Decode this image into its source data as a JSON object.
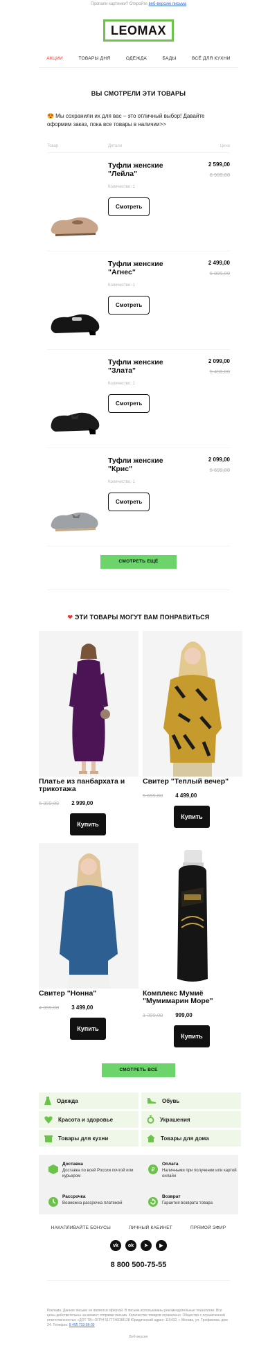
{
  "preheader": {
    "text": "Пропали картинки? Откройте",
    "link": "веб-версию письма"
  },
  "logo": "LEOMAX",
  "nav": [
    "АКЦИИ",
    "ТОВАРЫ ДНЯ",
    "ОДЕЖДА",
    "БАДЫ",
    "ВСЁ ДЛЯ КУХНИ"
  ],
  "viewed": {
    "title": "ВЫ СМОТРЕЛИ ЭТИ ТОВАРЫ",
    "lead": "😍 Мы сохранили их для вас – это отличный выбор! Давайте оформим заказ, пока все товары в наличии>>",
    "headers": {
      "product": "Товар",
      "details": "Детали",
      "price": "Цена"
    },
    "items": [
      {
        "title": "Туфли женские \"Лейла\"",
        "qty": "Количество: 1",
        "button": "Смотреть",
        "price": "2 599,00",
        "old": "6 999,00",
        "color": "#c8a488"
      },
      {
        "title": "Туфли женские \"Агнес\"",
        "qty": "Количество: 1",
        "button": "Смотреть",
        "price": "2 499,00",
        "old": "6 899,00",
        "color": "#151515"
      },
      {
        "title": "Туфли женские \"Злата\"",
        "qty": "Количество: 1",
        "button": "Смотреть",
        "price": "2 099,00",
        "old": "5 499,00",
        "color": "#1a1a1a"
      },
      {
        "title": "Туфли женские \"Крис\"",
        "qty": "Количество: 1",
        "button": "Смотреть",
        "price": "2 099,00",
        "old": "5 699,00",
        "color": "#9ea2a6"
      }
    ],
    "more_button": "СМОТРЕТЬ ЕЩЁ"
  },
  "recommend": {
    "title": "ЭТИ ТОВАРЫ МОГУТ ВАМ ПОНРАВИТЬСЯ",
    "items": [
      {
        "name": "Платье из панбархата и трикотажа",
        "old": "5 399,00",
        "price": "2 999,00",
        "button": "Купить"
      },
      {
        "name": "Свитер \"Теплый вечер\"",
        "old": "5 699,00",
        "price": "4 499,00",
        "button": "Купить"
      },
      {
        "name": "Свитер \"Нонна\"",
        "old": "4 399,00",
        "price": "3 499,00",
        "button": "Купить"
      },
      {
        "name": "Комплекс Мумиё \"Мумимарин Море\"",
        "old": "1 399,00",
        "price": "999,00",
        "button": "Купить"
      }
    ],
    "all_button": "СМОТРЕТЬ ВСЕ"
  },
  "categories": [
    {
      "label": "Одежда",
      "icon": "dress-icon"
    },
    {
      "label": "Обувь",
      "icon": "shoe-icon"
    },
    {
      "label": "Красота и здоровье",
      "icon": "heart-icon"
    },
    {
      "label": "Украшения",
      "icon": "ring-icon"
    },
    {
      "label": "Товары для кухни",
      "icon": "pot-icon"
    },
    {
      "label": "Товары для дома",
      "icon": "house-icon"
    }
  ],
  "info": [
    {
      "title": "Доставка",
      "text": "Доставка по всей России почтой или курьером",
      "icon": "box-icon"
    },
    {
      "title": "Оплата",
      "text": "Наличными при получении или картой онлайн",
      "icon": "ruble-icon"
    },
    {
      "title": "Рассрочка",
      "text": "Возможна рассрочка платежей",
      "icon": "clock-icon"
    },
    {
      "title": "Возврат",
      "text": "Гарантия возврата товара",
      "icon": "return-icon"
    }
  ],
  "footer_links": [
    "НАКАПЛИВАЙТЕ БОНУСЫ",
    "ЛИЧНЫЙ КАБИНЕТ",
    "ПРЯМОЙ ЭФИР"
  ],
  "social": [
    "vk-icon",
    "ok-icon",
    "telegram-icon",
    "youtube-icon"
  ],
  "phone": "8 800 500-75-55",
  "legal": "Реклама. Данное письмо не является офертой. В письме использованы рекомендательные технологии. Все цены действительны на момент отправки письма. Количество товаров ограничено. Общество с ограниченной ответственностью «ДОТ ТВ» ОГРН 5177746038128 Юридический адрес: 115432, г. Москва, ул. Трофимова, дом 24. Телефон:",
  "legal_phone": "8 495 733-96-03",
  "web_version": "Веб-версия",
  "colors": {
    "accent": "#6cd46a",
    "logo_border": "#6cc24a",
    "sale_red": "#e53935",
    "category_bg": "#eef7e8"
  }
}
